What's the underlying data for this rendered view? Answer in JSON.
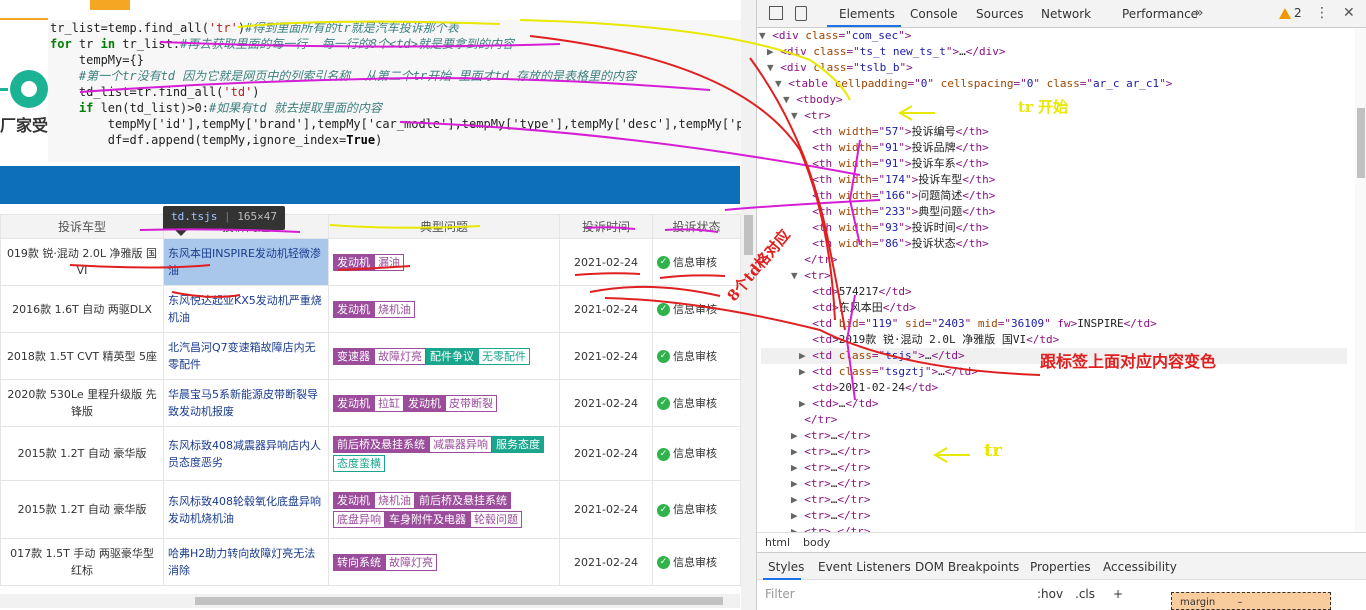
{
  "code_lines": [
    {
      "indent": "",
      "kw": "",
      "text": "tr_list=temp.find_all(",
      "str": "'tr'",
      "rest": ")",
      "cm": "#得到里面所有的tr就是汽车投诉那个表"
    },
    {
      "indent": "",
      "kw": "for",
      "text": " tr ",
      "kw2": "in",
      "rest": " tr_list:",
      "cm": "#再去获取里面的每一行  每一行的8个<td>就是要拿到的内容"
    },
    {
      "indent": "    ",
      "text": "tempMy={}"
    },
    {
      "indent": "    ",
      "cm": "#第一个tr没有td 因为它就是网页中的列索引名称  从第二个tr开始 里面才td 存放的是表格里的内容"
    },
    {
      "indent": "    ",
      "text": "td_list=tr.find_all(",
      "str": "'td'",
      "rest": ")"
    },
    {
      "indent": "    ",
      "kw": "if",
      "text": " len(td_list)>0:",
      "cm": "#如果有td 就去提取里面的内容"
    },
    {
      "indent": "        ",
      "text": "tempMy['id'],tempMy['brand'],tempMy['car_modle'],tempMy['type'],tempMy['desc'],tempMy['prob"
    },
    {
      "indent": "        ",
      "text": "df=df.append(tempMy,ignore_index=",
      "kw": "True",
      "rest": ")"
    }
  ],
  "brand_fragment": "厂家受",
  "tooltip": {
    "tag": "td.tsjs",
    "size": "165×47"
  },
  "table": {
    "headers": [
      "投诉车型",
      "投诉问题",
      "典型问题",
      "投诉时间",
      "投诉状态"
    ],
    "rows": [
      {
        "model": "019款 锐·混动 2.0L 净雅版 国VI",
        "summary": "东风本田INSPIRE发动机轻微渗油",
        "tags": [
          [
            "发动机",
            "p"
          ],
          [
            "漏油",
            "po"
          ]
        ],
        "time": "2021-02-24",
        "status": "信息审核",
        "selected": true
      },
      {
        "model": "2016款 1.6T 自动 两驱DLX",
        "summary": "东风悦达起亚KX5发动机严重烧机油",
        "tags": [
          [
            "发动机",
            "p"
          ],
          [
            "烧机油",
            "po"
          ]
        ],
        "time": "2021-02-24",
        "status": "信息审核"
      },
      {
        "model": "2018款 1.5T CVT 精英型 5座",
        "summary": "北汽昌河Q7变速箱故障店内无零配件",
        "tags": [
          [
            "变速器",
            "p"
          ],
          [
            "故障灯亮",
            "po"
          ],
          [
            "配件争议",
            "g"
          ],
          [
            "无零配件",
            "go"
          ]
        ],
        "time": "2021-02-24",
        "status": "信息审核"
      },
      {
        "model": "2020款 530Le 里程升级版 先锋版",
        "summary": "华晨宝马5系新能源皮带断裂导致发动机报废",
        "tags": [
          [
            "发动机",
            "p"
          ],
          [
            "拉缸",
            "po"
          ],
          [
            "发动机",
            "p"
          ],
          [
            "皮带断裂",
            "po"
          ]
        ],
        "time": "2021-02-24",
        "status": "信息审核"
      },
      {
        "model": "2015款 1.2T 自动 豪华版",
        "summary": "东风标致408减震器异响店内人员态度恶劣",
        "tags": [
          [
            "前后桥及悬挂系统",
            "p"
          ],
          [
            "减震器异响",
            "po"
          ],
          [
            "服务态度",
            "g"
          ],
          [
            "态度蛮横",
            "go"
          ]
        ],
        "time": "2021-02-24",
        "status": "信息审核"
      },
      {
        "model": "2015款 1.2T 自动 豪华版",
        "summary": "东风标致408轮毂氧化底盘异响发动机烧机油",
        "tags": [
          [
            "发动机",
            "p"
          ],
          [
            "烧机油",
            "po"
          ],
          [
            "前后桥及悬挂系统",
            "p"
          ],
          [
            "底盘异响",
            "po"
          ],
          [
            "车身附件及电器",
            "p"
          ],
          [
            "轮毂问题",
            "po"
          ]
        ],
        "time": "2021-02-24",
        "status": "信息审核"
      },
      {
        "model": "017款 1.5T 手动 两驱豪华型 红标",
        "summary": "哈弗H2助力转向故障灯亮无法消除",
        "tags": [
          [
            "转向系统",
            "p"
          ],
          [
            "故障灯亮",
            "po"
          ]
        ],
        "time": "2021-02-24",
        "status": "信息审核"
      }
    ]
  },
  "devtools": {
    "tabs": [
      "Elements",
      "Console",
      "Sources",
      "Network",
      "Performance"
    ],
    "warning_count": "2",
    "dom_lines": [
      {
        "i": 2,
        "a": "▼",
        "h": "<div class=\"com_sec\">"
      },
      {
        "i": 3,
        "a": "▶",
        "h": "<div class=\"ts_t new_ts_t\">…</div>"
      },
      {
        "i": 3,
        "a": "▼",
        "h": "<div class=\"tslb_b\">"
      },
      {
        "i": 4,
        "a": "▼",
        "h": "<table cellpadding=\"0\" cellspacing=\"0\" class=\"ar_c ar_c1\">"
      },
      {
        "i": 5,
        "a": "▼",
        "h": "<tbody>"
      },
      {
        "i": 6,
        "a": "▼",
        "h": "<tr>"
      },
      {
        "i": 7,
        "a": "",
        "h": "<th width=\"57\">投诉编号</th>"
      },
      {
        "i": 7,
        "a": "",
        "h": "<th width=\"91\">投诉品牌</th>"
      },
      {
        "i": 7,
        "a": "",
        "h": "<th width=\"91\">投诉车系</th>"
      },
      {
        "i": 7,
        "a": "",
        "h": "<th width=\"174\">投诉车型</th>"
      },
      {
        "i": 7,
        "a": "",
        "h": "<th width=\"166\">问题简述</th>"
      },
      {
        "i": 7,
        "a": "",
        "h": "<th width=\"233\">典型问题</th>"
      },
      {
        "i": 7,
        "a": "",
        "h": "<th width=\"93\">投诉时间</th>"
      },
      {
        "i": 7,
        "a": "",
        "h": "<th width=\"86\">投诉状态</th>"
      },
      {
        "i": 6,
        "a": "",
        "h": "</tr>"
      },
      {
        "i": 6,
        "a": "▼",
        "h": "<tr>"
      },
      {
        "i": 7,
        "a": "",
        "h": "<td>574217</td>"
      },
      {
        "i": 7,
        "a": "",
        "h": "<td>东风本田</td>"
      },
      {
        "i": 7,
        "a": "",
        "h": "<td bid=\"119\" sid=\"2403\" mid=\"36109\" fw>INSPIRE</td>"
      },
      {
        "i": 7,
        "a": "",
        "h": "<td>2019款 锐·混动 2.0L 净雅版 国VI</td>"
      },
      {
        "i": 7,
        "a": "▶",
        "h": "<td class=\"tsjs\">…</td>",
        "hl": true
      },
      {
        "i": 7,
        "a": "▶",
        "h": "<td class=\"tsgztj\">…</td>"
      },
      {
        "i": 7,
        "a": "",
        "h": "<td>2021-02-24</td>"
      },
      {
        "i": 7,
        "a": "▶",
        "h": "<td>…</td>"
      },
      {
        "i": 6,
        "a": "",
        "h": "</tr>"
      },
      {
        "i": 6,
        "a": "▶",
        "h": "<tr>…</tr>"
      },
      {
        "i": 6,
        "a": "▶",
        "h": "<tr>…</tr>"
      },
      {
        "i": 6,
        "a": "▶",
        "h": "<tr>…</tr>"
      },
      {
        "i": 6,
        "a": "▶",
        "h": "<tr>…</tr>"
      },
      {
        "i": 6,
        "a": "▶",
        "h": "<tr>…</tr>"
      },
      {
        "i": 6,
        "a": "▶",
        "h": "<tr>…</tr>"
      },
      {
        "i": 6,
        "a": "▶",
        "h": "<tr>…</tr>"
      }
    ],
    "crumbs": [
      "html",
      "body"
    ],
    "style_tabs": [
      "Styles",
      "Event Listeners",
      "DOM Breakpoints",
      "Properties",
      "Accessibility"
    ],
    "filter_placeholder": "Filter",
    "filter_hov": ":hov",
    "filter_cls": ".cls",
    "filter_add": "+",
    "box_label": "margin",
    "box_value": "–"
  },
  "annotations": {
    "tr_start": "tr 开始",
    "eight_cells": "8个td格对应",
    "cell_contents": "跟标签上面对应内容变色",
    "tr_label": "tr"
  },
  "colors": {
    "accent": "#1a73e8",
    "bar": "#0d6fba",
    "status_ok": "#2fb34a",
    "tag_purple": "#9b4c9b",
    "tag_teal": "#19a68c"
  }
}
